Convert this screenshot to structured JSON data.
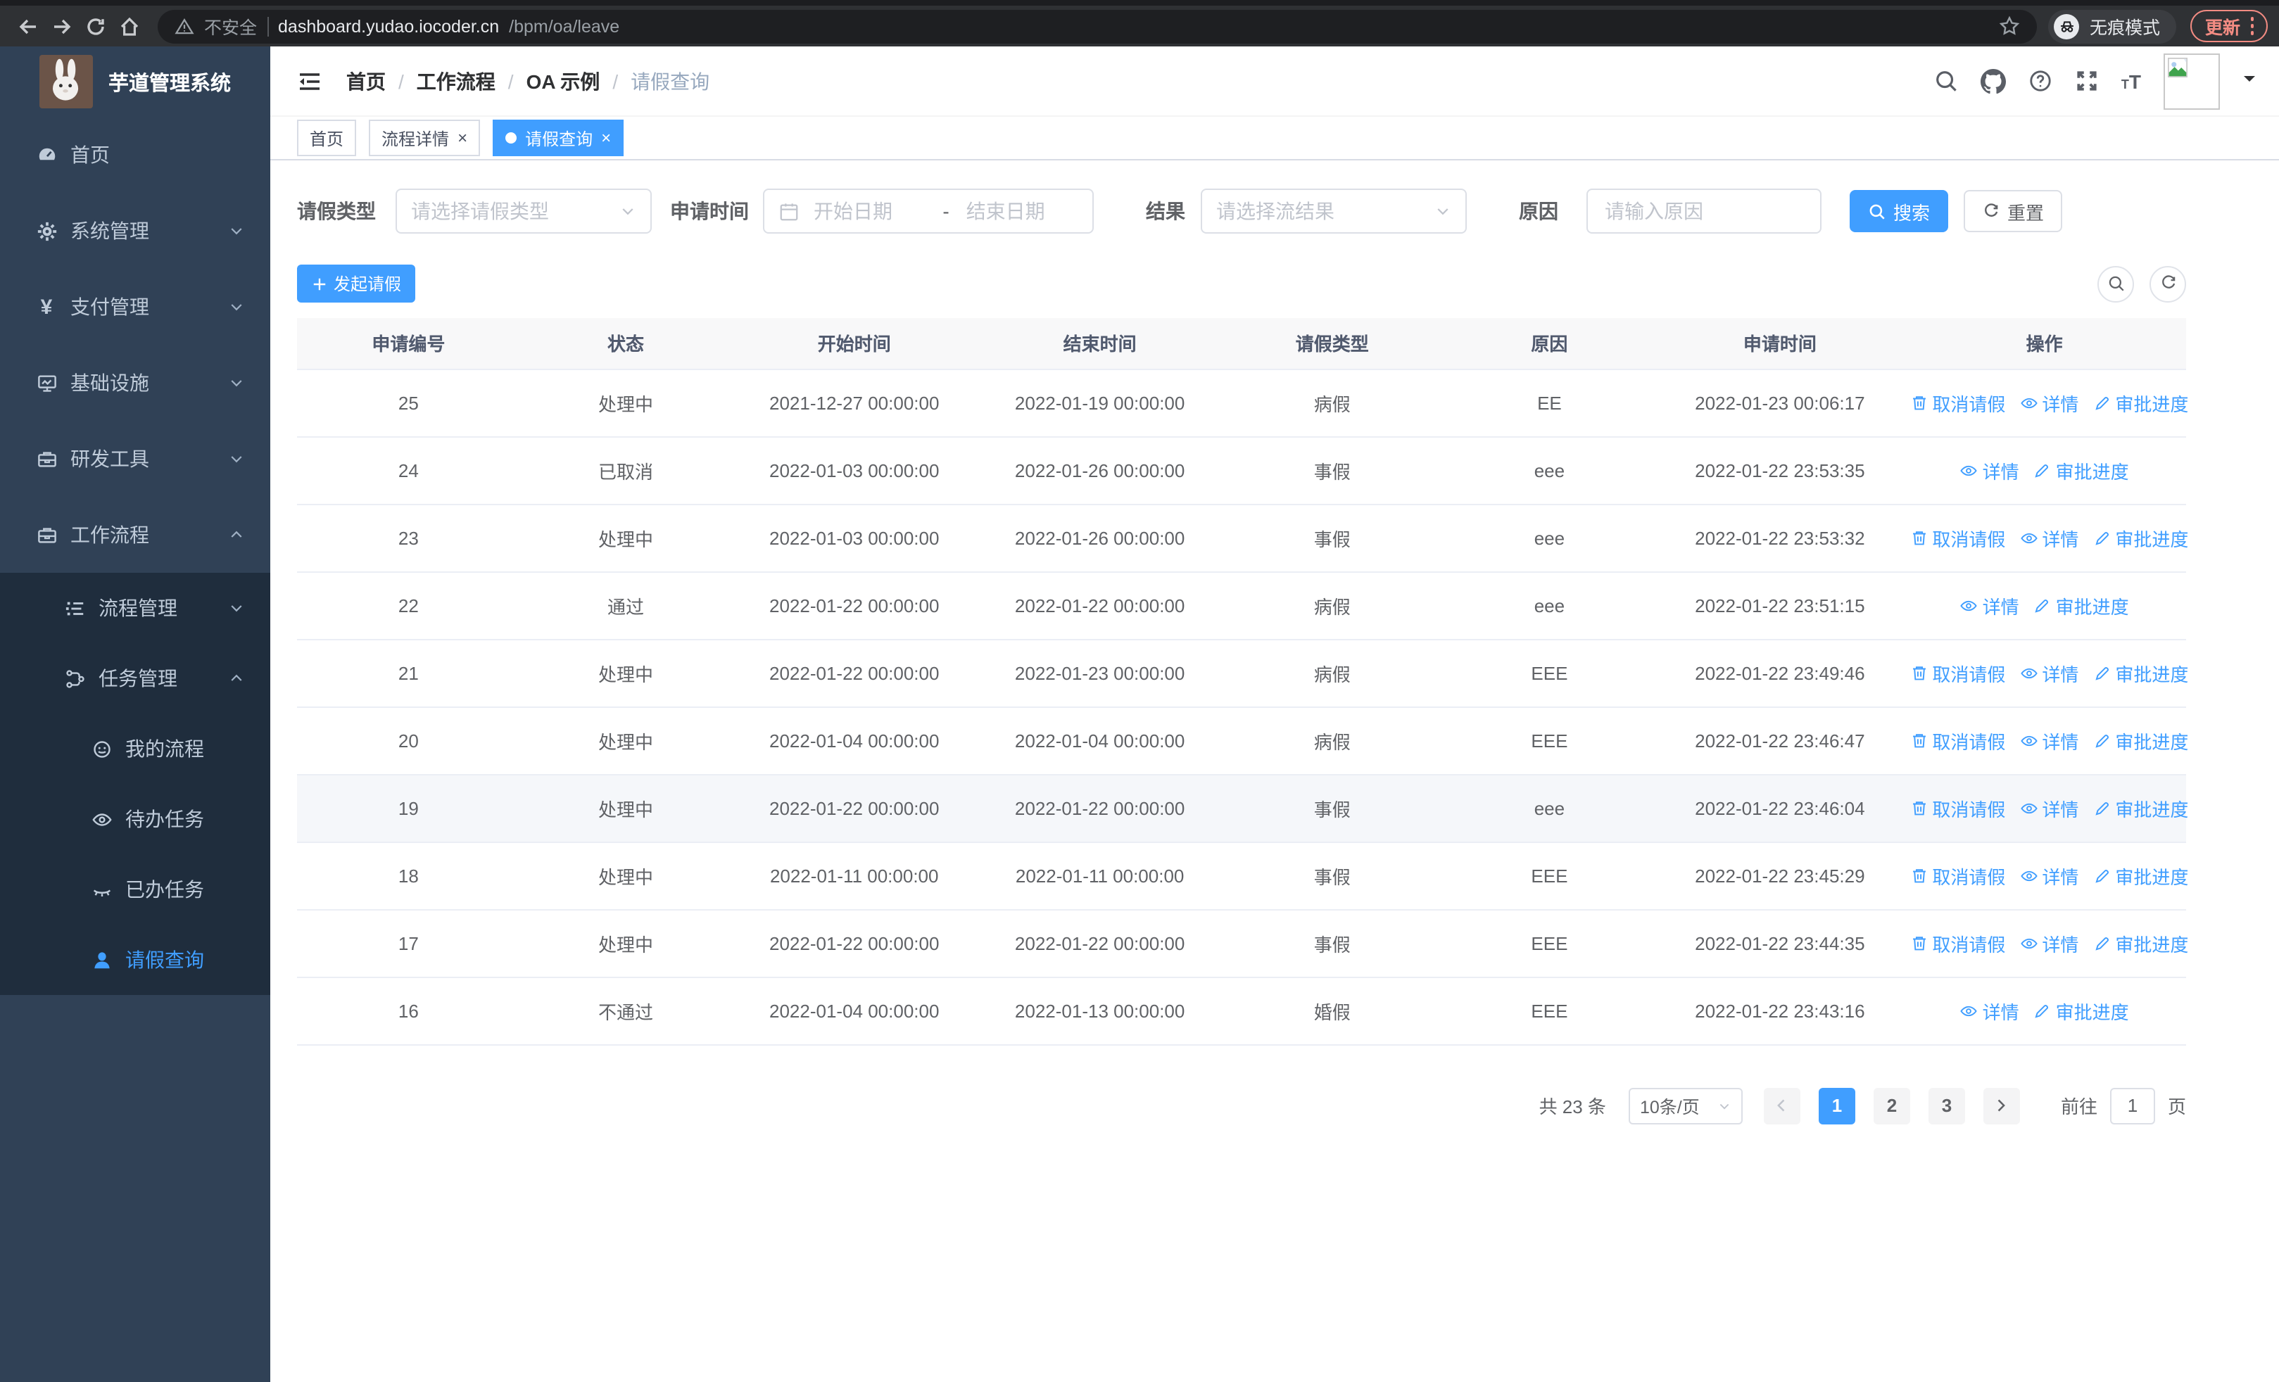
{
  "colors": {
    "primary": "#409eff",
    "sidebar_bg": "#304156",
    "submenu_bg": "#1f2d3d",
    "update_accent": "#f28b82"
  },
  "browser": {
    "security_label": "不安全",
    "url_host": "dashboard.yudao.iocoder.cn",
    "url_path": "/bpm/oa/leave",
    "incognito_label": "无痕模式",
    "update_label": "更新"
  },
  "sidebar": {
    "title": "芋道管理系统",
    "items": [
      {
        "label": "首页",
        "icon": "dashboard",
        "level": 1
      },
      {
        "label": "系统管理",
        "icon": "gear",
        "level": 1,
        "chevron": "down"
      },
      {
        "label": "支付管理",
        "icon": "yen",
        "level": 1,
        "chevron": "down"
      },
      {
        "label": "基础设施",
        "icon": "monitor",
        "level": 1,
        "chevron": "down"
      },
      {
        "label": "研发工具",
        "icon": "toolbox",
        "level": 1,
        "chevron": "down"
      },
      {
        "label": "工作流程",
        "icon": "briefcase",
        "level": 1,
        "chevron": "up"
      },
      {
        "label": "流程管理",
        "icon": "list-tree",
        "level": 2,
        "dark": true,
        "chevron": "down"
      },
      {
        "label": "任务管理",
        "icon": "flow",
        "level": 2,
        "dark": true,
        "chevron": "up"
      },
      {
        "label": "我的流程",
        "icon": "face",
        "level": 3,
        "dark": true
      },
      {
        "label": "待办任务",
        "icon": "eye",
        "level": 3,
        "dark": true
      },
      {
        "label": "已办任务",
        "icon": "eye-closed",
        "level": 3,
        "dark": true
      },
      {
        "label": "请假查询",
        "icon": "user",
        "level": 3,
        "dark": true,
        "active": true
      }
    ]
  },
  "header": {
    "breadcrumb": [
      "首页",
      "工作流程",
      "OA 示例",
      "请假查询"
    ],
    "separator": "/"
  },
  "tabs": [
    {
      "label": "首页",
      "closable": false,
      "active": false
    },
    {
      "label": "流程详情",
      "closable": true,
      "active": false
    },
    {
      "label": "请假查询",
      "closable": true,
      "active": true
    }
  ],
  "filters": {
    "leave_type": {
      "label": "请假类型",
      "placeholder": "请选择请假类型"
    },
    "apply_time": {
      "label": "申请时间",
      "start_placeholder": "开始日期",
      "separator": "-",
      "end_placeholder": "结束日期"
    },
    "result": {
      "label": "结果",
      "placeholder": "请选择流结果"
    },
    "reason": {
      "label": "原因",
      "placeholder": "请输入原因"
    },
    "search_label": "搜索",
    "reset_label": "重置"
  },
  "toolbar": {
    "create_label": "发起请假"
  },
  "table": {
    "columns": [
      "申请编号",
      "状态",
      "开始时间",
      "结束时间",
      "请假类型",
      "原因",
      "申请时间",
      "操作"
    ],
    "action_labels": {
      "cancel": "取消请假",
      "detail": "详情",
      "progress": "审批进度"
    },
    "rows": [
      {
        "id": "25",
        "status": "处理中",
        "start": "2021-12-27 00:00:00",
        "end": "2022-01-19 00:00:00",
        "type": "病假",
        "reason": "EE",
        "apply_time": "2022-01-23 00:06:17",
        "actions": [
          "cancel",
          "detail",
          "progress"
        ]
      },
      {
        "id": "24",
        "status": "已取消",
        "start": "2022-01-03 00:00:00",
        "end": "2022-01-26 00:00:00",
        "type": "事假",
        "reason": "eee",
        "apply_time": "2022-01-22 23:53:35",
        "actions": [
          "detail",
          "progress"
        ]
      },
      {
        "id": "23",
        "status": "处理中",
        "start": "2022-01-03 00:00:00",
        "end": "2022-01-26 00:00:00",
        "type": "事假",
        "reason": "eee",
        "apply_time": "2022-01-22 23:53:32",
        "actions": [
          "cancel",
          "detail",
          "progress"
        ]
      },
      {
        "id": "22",
        "status": "通过",
        "start": "2022-01-22 00:00:00",
        "end": "2022-01-22 00:00:00",
        "type": "病假",
        "reason": "eee",
        "apply_time": "2022-01-22 23:51:15",
        "actions": [
          "detail",
          "progress"
        ]
      },
      {
        "id": "21",
        "status": "处理中",
        "start": "2022-01-22 00:00:00",
        "end": "2022-01-23 00:00:00",
        "type": "病假",
        "reason": "EEE",
        "apply_time": "2022-01-22 23:49:46",
        "actions": [
          "cancel",
          "detail",
          "progress"
        ]
      },
      {
        "id": "20",
        "status": "处理中",
        "start": "2022-01-04 00:00:00",
        "end": "2022-01-04 00:00:00",
        "type": "病假",
        "reason": "EEE",
        "apply_time": "2022-01-22 23:46:47",
        "actions": [
          "cancel",
          "detail",
          "progress"
        ]
      },
      {
        "id": "19",
        "status": "处理中",
        "start": "2022-01-22 00:00:00",
        "end": "2022-01-22 00:00:00",
        "type": "事假",
        "reason": "eee",
        "apply_time": "2022-01-22 23:46:04",
        "actions": [
          "cancel",
          "detail",
          "progress"
        ],
        "hovered": true
      },
      {
        "id": "18",
        "status": "处理中",
        "start": "2022-01-11 00:00:00",
        "end": "2022-01-11 00:00:00",
        "type": "事假",
        "reason": "EEE",
        "apply_time": "2022-01-22 23:45:29",
        "actions": [
          "cancel",
          "detail",
          "progress"
        ]
      },
      {
        "id": "17",
        "status": "处理中",
        "start": "2022-01-22 00:00:00",
        "end": "2022-01-22 00:00:00",
        "type": "事假",
        "reason": "EEE",
        "apply_time": "2022-01-22 23:44:35",
        "actions": [
          "cancel",
          "detail",
          "progress"
        ]
      },
      {
        "id": "16",
        "status": "不通过",
        "start": "2022-01-04 00:00:00",
        "end": "2022-01-13 00:00:00",
        "type": "婚假",
        "reason": "EEE",
        "apply_time": "2022-01-22 23:43:16",
        "actions": [
          "detail",
          "progress"
        ]
      }
    ]
  },
  "pagination": {
    "total_label": "共 23 条",
    "page_size": "10条/页",
    "pages": [
      "1",
      "2",
      "3"
    ],
    "active_page": "1",
    "goto_label": "前往",
    "goto_value": "1",
    "unit_label": "页"
  }
}
